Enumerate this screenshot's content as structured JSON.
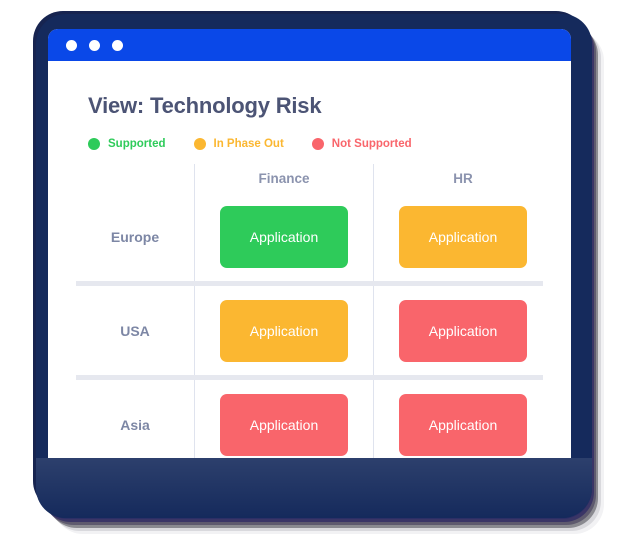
{
  "window": {
    "dots": [
      "window-dot-1",
      "window-dot-2",
      "window-dot-3"
    ],
    "titlebar_color": "#0a48e8"
  },
  "header": {
    "title": "View: Technology Risk"
  },
  "legend": {
    "items": [
      {
        "label": "Supported",
        "color": "#2ecb5a",
        "icon": "status-dot-icon"
      },
      {
        "label": "In Phase Out",
        "color": "#fbb731",
        "icon": "status-dot-icon"
      },
      {
        "label": "Not Supported",
        "color": "#f9656b",
        "icon": "status-dot-icon"
      }
    ]
  },
  "matrix": {
    "corner_label": "",
    "columns": [
      "Finance",
      "HR"
    ],
    "rows": [
      {
        "label": "Europe",
        "cells": [
          {
            "label": "Application",
            "status": "Supported",
            "color": "#2ecb5a"
          },
          {
            "label": "Application",
            "status": "In Phase Out",
            "color": "#fbb731"
          }
        ]
      },
      {
        "label": "USA",
        "cells": [
          {
            "label": "Application",
            "status": "In Phase Out",
            "color": "#fbb731"
          },
          {
            "label": "Application",
            "status": "Not Supported",
            "color": "#f9656b"
          }
        ]
      },
      {
        "label": "Asia",
        "cells": [
          {
            "label": "Application",
            "status": "Not Supported",
            "color": "#f9656b"
          },
          {
            "label": "Application",
            "status": "Not Supported",
            "color": "#f9656b"
          }
        ]
      }
    ]
  },
  "colors": {
    "title_text": "#4c5475",
    "header_text": "#8b93ae",
    "row_label_text": "#7d87a5",
    "navy": "#152a5c",
    "divider": "#dfe3ee"
  }
}
